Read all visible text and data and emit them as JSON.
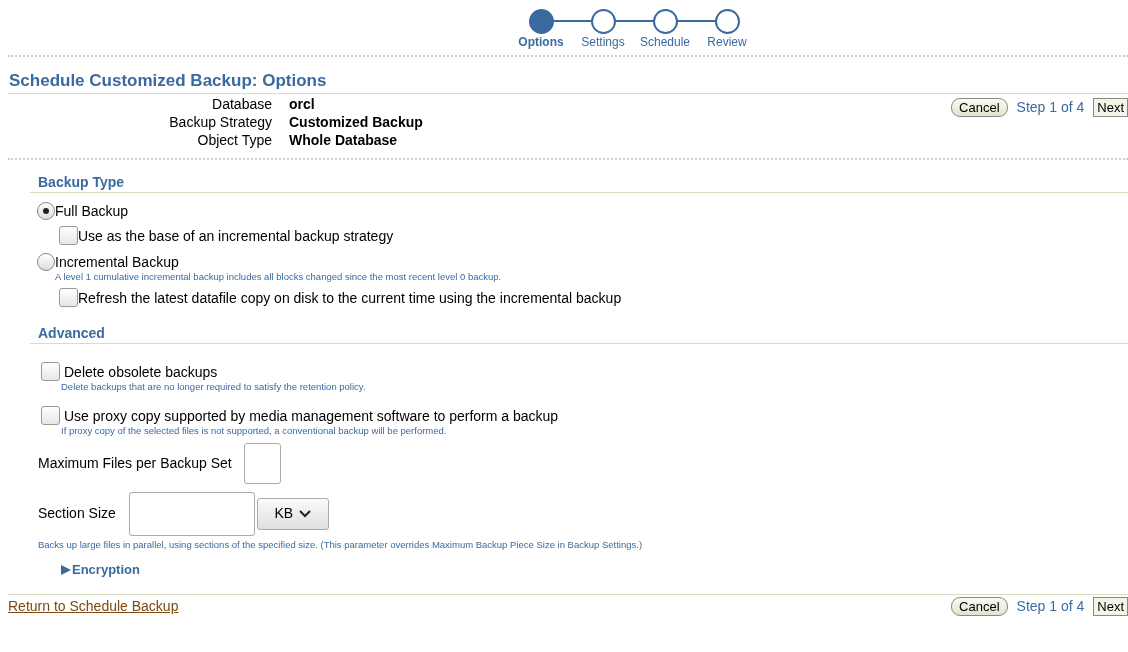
{
  "train": [
    {
      "label": "Options",
      "selected": true
    },
    {
      "label": "Settings",
      "selected": false
    },
    {
      "label": "Schedule",
      "selected": false
    },
    {
      "label": "Review",
      "selected": false
    }
  ],
  "page_title": "Schedule Customized Backup: Options",
  "info": [
    {
      "label": "Database",
      "value": "orcl"
    },
    {
      "label": "Backup Strategy",
      "value": "Customized Backup"
    },
    {
      "label": "Object Type",
      "value": "Whole Database"
    }
  ],
  "top_actions": {
    "cancel": "Cancel",
    "step": "Step 1 of 4",
    "next": "Next"
  },
  "backup_type": {
    "heading": "Backup Type",
    "options": [
      {
        "label": "Full Backup",
        "selected": true,
        "children": [
          {
            "label": "Use as the base of an incremental backup strategy",
            "checked": false
          }
        ]
      },
      {
        "label": "Incremental Backup",
        "selected": false,
        "hint": "A level 1 cumulative incremental backup includes all blocks changed since the most recent level 0 backup.",
        "children": [
          {
            "label": "Refresh the latest datafile copy on disk to the current time using the incremental backup",
            "checked": false
          }
        ]
      }
    ]
  },
  "advanced": {
    "heading": "Advanced",
    "options": [
      {
        "label": "Delete obsolete backups",
        "checked": false,
        "hint": "Delete backups that are no longer required to satisfy the retention policy."
      },
      {
        "label": "Use proxy copy supported by media management software to perform a backup",
        "checked": false,
        "hint": "If proxy copy of the selected files is not supported, a conventional backup will be performed."
      }
    ],
    "max_files": {
      "label": "Maximum Files per Backup Set"
    },
    "section_size": {
      "label": "Section Size",
      "unit": "KB",
      "hint": "Backs up large files in parallel, using sections of the specified size. (This parameter overrides Maximum Backup Piece Size in Backup Settings.)"
    },
    "encryption": {
      "label": "Encryption",
      "expanded": false
    }
  },
  "footer": {
    "link": "Return to Schedule Backup",
    "cancel": "Cancel",
    "step": "Step 1 of 4",
    "next": "Next"
  }
}
